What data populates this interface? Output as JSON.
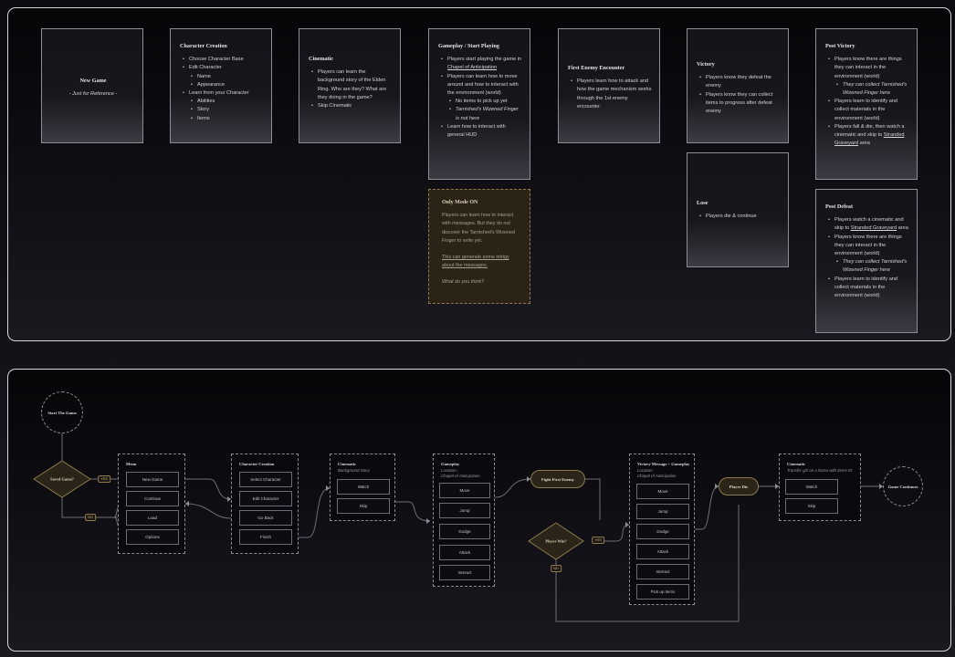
{
  "top": {
    "new_game": {
      "title": "New Game",
      "note": "- Just for Reference -"
    },
    "character_creation": {
      "title": "Character Creation",
      "items": [
        "Choose Character Base",
        "Edit Character",
        "Name",
        "Appearance",
        "Learn from your Character",
        "Abilities",
        "Story",
        "Items"
      ]
    },
    "cinematic": {
      "title": "Cinematic",
      "items": [
        "Players can learn the background story of the Elden Ring. Who are they? What are they doing in the game?",
        "Skip Cinematic"
      ]
    },
    "gameplay": {
      "title": "Gameplay / Start Playing",
      "item1_pre": "Players start playing the game in ",
      "item1_link": "Chapel of Anticipation",
      "item2": "Players can learn how to move around and how to interact with the environment (world)",
      "sub1": "No items to pick up yet",
      "sub2": "Tarnished's Wizened Finger is not here",
      "item3": "Learn how to interact with general HUD"
    },
    "first_enemy": {
      "title": "First Enemy Encounter",
      "items": [
        "Players learn how to attack and how the game mechanism works through the 1st enemy encounter."
      ]
    },
    "victory": {
      "title": "Victory",
      "items": [
        "Players know they defeat the enemy",
        "Players know they can collect items to progress after defeat enemy"
      ]
    },
    "lose": {
      "title": "Lose",
      "items": [
        "Players die & continue"
      ]
    },
    "post_victory": {
      "title": "Post Victory",
      "item1": "Players know there are things they can interact in the environment (world)",
      "sub1": "They can collect Tarnished's Wizened Finger here",
      "item2": "Players learn to identify and collect materials in the environment (world)",
      "item3_pre": "Players fall & die, then watch a cinematic and skip to ",
      "item3_link": "Stranded Graveyard",
      "item3_post": " area"
    },
    "post_defeat": {
      "title": "Post Defeat",
      "item1_pre": "Players watch a cinematic and skip to ",
      "item1_link": "Stranded Graveyard",
      "item1_post": " area",
      "item2": "Players know there are things they can interact in the environment (world)",
      "sub1": "They can collect Tarnished's Wizened Finger here",
      "item3": "Players learn to identify and collect materials in the environment (world)"
    },
    "note": {
      "title": "Only Mode ON",
      "p1": "Players can learn how to interact with messages. But they do not discover the Tarnished's Wizened Finger to write yet.",
      "p2": "This can generate some intrigy about the messages.",
      "p3": "What do you think?"
    }
  },
  "flow": {
    "start": "Start The Game",
    "saved_game": "Saved Game?",
    "menu": {
      "title": "Menu",
      "buttons": [
        "New Game",
        "Continue",
        "Load",
        "Options"
      ]
    },
    "char": {
      "title": "Character Creation",
      "buttons": [
        "Select Character",
        "Edit Character",
        "Go Back",
        "Finish"
      ]
    },
    "cine1": {
      "title": "Cinematic",
      "sub": "Background Story",
      "buttons": [
        "Watch",
        "Skip"
      ]
    },
    "game1": {
      "title": "Gameplay",
      "sub1": "Location:",
      "sub2": "Chapel of Anticipation",
      "buttons": [
        "Move",
        "Jump",
        "Dodge",
        "Attack",
        "Interact"
      ]
    },
    "fight": "Fight First Enemy",
    "player_win": "Player Win?",
    "game2": {
      "title": "Victory Message + Gameplay",
      "sub1": "Location:",
      "sub2": "Chapel of Anticipation",
      "buttons": [
        "Move",
        "Jump",
        "Dodge",
        "Attack",
        "Interact",
        "Pick up items"
      ]
    },
    "player_die": "Player Die",
    "cine2": {
      "title": "Cinematic",
      "sub": "Transfer girl on a horse with items ID",
      "buttons": [
        "Watch",
        "Skip"
      ]
    },
    "continues": "Game Continues",
    "yes": "YES",
    "no": "NO"
  }
}
